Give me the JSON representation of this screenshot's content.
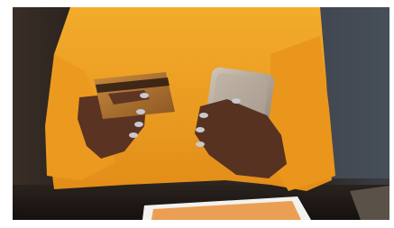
{
  "photo": {
    "subject": "person-with-credit-card-and-smartphone",
    "colors": {
      "sweater": "#f0a324",
      "skin": "#5a3322",
      "card": "#b0712c",
      "phone": "#a89a8a",
      "background": "#2a2420",
      "table": "#1c1816",
      "tablet_frame": "#f3f1ee"
    }
  }
}
